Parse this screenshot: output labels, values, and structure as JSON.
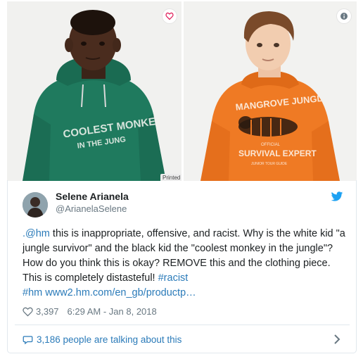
{
  "images": {
    "left_hoodie_text": "COOLEST MONKE",
    "left_hoodie_text2": "IN THE JUNG",
    "right_hoodie_text": "MANGROVE JUNGL",
    "right_hoodie_text2": "OFFICIAL",
    "right_hoodie_text3": "SURVIVAL EXPERT",
    "right_hoodie_text4": "JUNIOR TOUR GUIDE",
    "printed_label": "Printed",
    "heart_icon": "heart-icon",
    "info_icon": "info-icon"
  },
  "tweet": {
    "name": "Selene Arianela",
    "handle": "@ArianelaSelene",
    "mention": ".@hm",
    "body": " this is inappropriate, offensive, and racist. Why is the white kid \"a jungle survivor\" and the black kid the \"coolest monkey in the jungle\"? How do you think this is okay? REMOVE this and the clothing piece. This is completely distasteful! ",
    "hashtag1": "#racist",
    "hashtag2": "#hm",
    "url": "www2.hm.com/en_gb/productp…",
    "likes": "3,397",
    "timestamp": "6:29 AM - Jan 8, 2018",
    "talking": "3,186 people are talking about this"
  },
  "colors": {
    "link": "#2b7bb9",
    "twitter_blue": "#1da1f2",
    "green_hoodie": "#1f7a5e",
    "orange_hoodie": "#ef7a24"
  }
}
